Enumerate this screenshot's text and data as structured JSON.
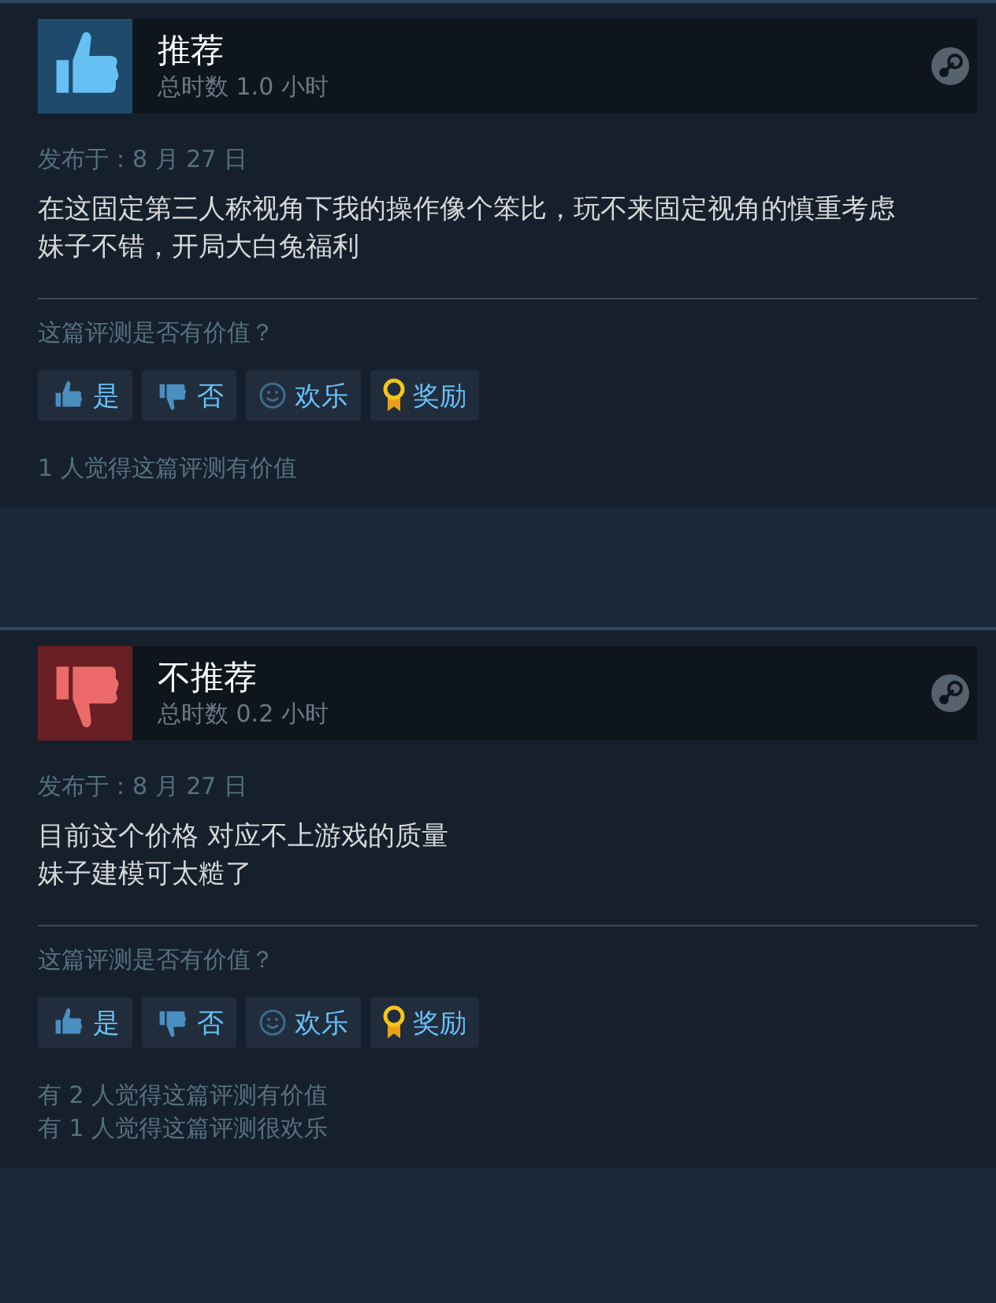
{
  "reviews": [
    {
      "recommended": true,
      "title": "推荐",
      "hours": "总时数 1.0 小时",
      "posted": "发布于：8 月 27 日",
      "body": [
        "在这固定第三人称视角下我的操作像个笨比，玩不来固定视角的慎重考虑",
        "妹子不错，开局大白兔福利"
      ],
      "question": "这篇评测是否有价值？",
      "buttons": [
        {
          "kind": "yes",
          "label": "是"
        },
        {
          "kind": "no",
          "label": "否"
        },
        {
          "kind": "funny",
          "label": "欢乐"
        },
        {
          "kind": "award",
          "label": "奖励"
        }
      ],
      "tallies": [
        "1 人觉得这篇评测有价值"
      ]
    },
    {
      "recommended": false,
      "title": "不推荐",
      "hours": "总时数 0.2 小时",
      "posted": "发布于：8 月 27 日",
      "body": [
        "目前这个价格 对应不上游戏的质量",
        "妹子建模可太糙了"
      ],
      "question": "这篇评测是否有价值？",
      "buttons": [
        {
          "kind": "yes",
          "label": "是"
        },
        {
          "kind": "no",
          "label": "否"
        },
        {
          "kind": "funny",
          "label": "欢乐"
        },
        {
          "kind": "award",
          "label": "奖励"
        }
      ],
      "tallies": [
        "有 2 人觉得这篇评测有价值",
        "有 1 人觉得这篇评测很欢乐"
      ]
    }
  ]
}
